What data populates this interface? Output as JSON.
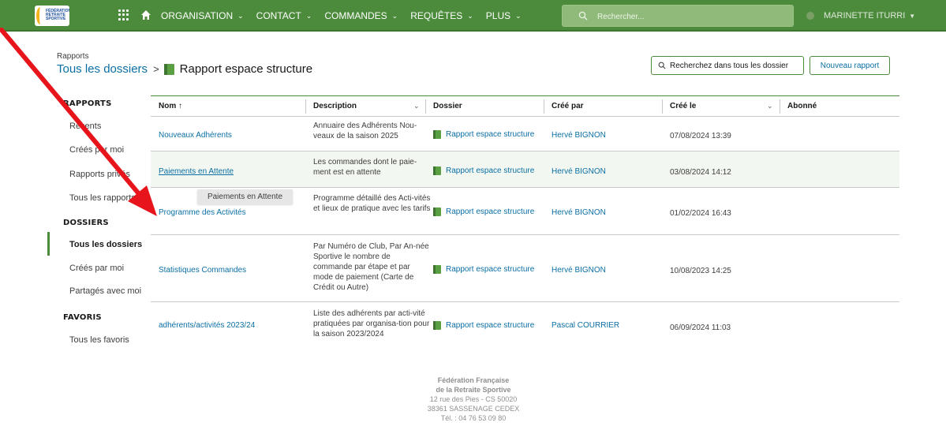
{
  "topbar": {
    "logo_text": "FÉDÉRATION RETRAITE SPORTIVE",
    "nav": [
      {
        "label": "ORGANISATION"
      },
      {
        "label": "CONTACT"
      },
      {
        "label": "COMMANDES"
      },
      {
        "label": "REQUÊTES"
      },
      {
        "label": "PLUS"
      }
    ],
    "search_placeholder": "Rechercher...",
    "user_name": "MARINETTE ITURRI",
    "color_bar": "#4c8a3c"
  },
  "header": {
    "small_title": "Rapports",
    "breadcrumb_root": "Tous les dossiers",
    "separator": ">",
    "current_folder": "Rapport espace structure",
    "search_button": "Recherchez dans tous les dossier",
    "new_button": "Nouveau rapport"
  },
  "sidebar": {
    "sections": [
      {
        "title": "RAPPORTS",
        "items": [
          "Récents",
          "Créés par moi",
          "Rapports privés",
          "Tous les rapports"
        ]
      },
      {
        "title": "DOSSIERS",
        "items": [
          "Tous les dossiers",
          "Créés par moi",
          "Partagés avec moi"
        ]
      },
      {
        "title": "FAVORIS",
        "items": [
          "Tous les favoris"
        ]
      }
    ],
    "active_item": "Tous les dossiers"
  },
  "table": {
    "columns": [
      "Nom ↑",
      "Description",
      "Dossier",
      "Créé par",
      "Créé le",
      "Abonné"
    ],
    "rows": [
      {
        "name": "Nouveaux Adhérents",
        "description": "Annuaire des Adhérents Nou-veaux de la saison 2025",
        "folder": "Rapport espace structure",
        "author": "Hervé BIGNON",
        "date": "07/08/2024 13:39"
      },
      {
        "name": "Paiements en Attente",
        "description": "Les commandes dont le paie-ment est en attente",
        "folder": "Rapport espace structure",
        "author": "Hervé BIGNON",
        "date": "03/08/2024 14:12"
      },
      {
        "name": "Programme des Activités",
        "description": "Programme détaillé des Acti-vités et lieux de pratique avec les tarifs",
        "folder": "Rapport espace structure",
        "author": "Hervé BIGNON",
        "date": "01/02/2024 16:43"
      },
      {
        "name": "Statistiques Commandes",
        "description": "Par Numéro de Club, Par An-née Sportive le nombre de commande par étape et par mode de paiement (Carte de Crédit ou Autre)",
        "folder": "Rapport espace structure",
        "author": "Hervé BIGNON",
        "date": "10/08/2023 14:25"
      },
      {
        "name": "adhérents/activités 2023/24",
        "description": "Liste des adhérents par acti-vité pratiquées par organisa-tion pour la saison 2023/2024",
        "folder": "Rapport espace structure",
        "author": "Pascal COURRIER",
        "date": "06/09/2024 11:03"
      }
    ],
    "tooltip": "Paiements en Attente"
  },
  "footer": {
    "line1": "Fédération Française",
    "line2": "de la Retraite Sportive",
    "line3": "12 rue des Pies - CS 50020",
    "line4": "38361 SASSENAGE CEDEX",
    "line5": "Tél. : 04 76 53 09 80"
  },
  "colors": {
    "brand_green": "#4c8a3c",
    "link_blue": "#0b6fa4",
    "annotation_red": "#e8141c"
  }
}
